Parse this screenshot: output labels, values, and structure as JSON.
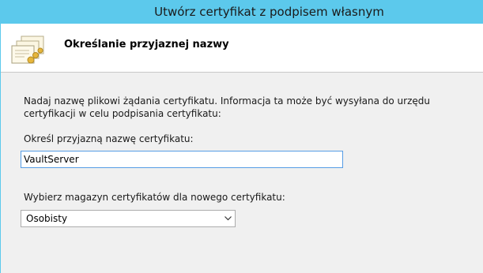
{
  "window": {
    "title": "Utwórz certyfikat z podpisem własnym"
  },
  "header": {
    "title": "Określanie przyjaznej nazwy",
    "icon": "certificate-icon"
  },
  "main": {
    "description": "Nadaj nazwę plikowi żądania certyfikatu. Informacja ta może być wysyłana do urzędu certyfikacji w celu podpisania certyfikatu:",
    "friendly_name_label": "Określ przyjazną nazwę certyfikatu:",
    "friendly_name_value": "VaultServer",
    "store_label": "Wybierz magazyn certyfikatów dla nowego certyfikatu:",
    "store_selected": "Osobisty"
  },
  "colors": {
    "title_bar": "#5cc9ec",
    "input_focus_border": "#569de5",
    "window_background": "#f0f0f0"
  }
}
